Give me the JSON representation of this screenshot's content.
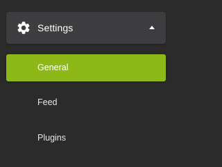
{
  "settings": {
    "label": "Settings",
    "icon": "gear-icon",
    "expanded": true
  },
  "submenu": {
    "items": [
      {
        "label": "General",
        "active": true
      },
      {
        "label": "Feed",
        "active": false
      },
      {
        "label": "Plugins",
        "active": false
      }
    ]
  },
  "colors": {
    "background": "#2b2b2b",
    "header_bg": "#3d3d3f",
    "accent": "#8db818",
    "text": "#ffffff"
  }
}
